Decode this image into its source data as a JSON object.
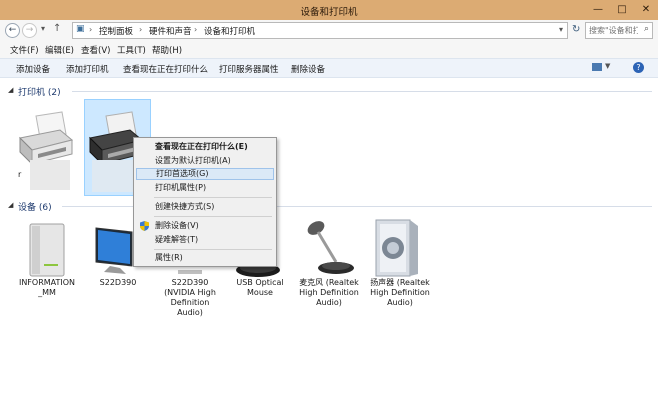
{
  "window": {
    "title": "设备和打印机",
    "min_glyph": "—",
    "max_glyph": "□",
    "close_glyph": "✕"
  },
  "address": {
    "crumbs": [
      "控制面板",
      "硬件和声音",
      "设备和打印机"
    ],
    "search_placeholder": "搜索\"设备和打..."
  },
  "menu": [
    "文件(F)",
    "编辑(E)",
    "查看(V)",
    "工具(T)",
    "帮助(H)"
  ],
  "commands": [
    "添加设备",
    "添加打印机",
    "查看现在正在打印什么",
    "打印服务器属性",
    "删除设备"
  ],
  "printers_section": {
    "title": "打印机 (2)"
  },
  "printers": [
    {
      "label": "r"
    }
  ],
  "devices_section": {
    "title": "设备 (6)"
  },
  "devices": [
    {
      "label_lines": [
        "INFORMATION",
        "_MM"
      ]
    },
    {
      "label_lines": [
        "S22D390"
      ]
    },
    {
      "label_lines": [
        "S22D390",
        "(NVIDIA High",
        "Definition",
        "Audio)"
      ]
    },
    {
      "label_lines": [
        "USB Optical",
        "Mouse"
      ]
    },
    {
      "label_lines": [
        "麦克风 (Realtek",
        "High Definition",
        "Audio)"
      ]
    },
    {
      "label_lines": [
        "扬声器 (Realtek",
        "High Definition",
        "Audio)"
      ]
    }
  ],
  "context_menu": {
    "items": [
      {
        "label": "查看现在正在打印什么(E)"
      },
      {
        "label": "设置为默认打印机(A)"
      },
      {
        "label": "打印首选项(G)"
      },
      {
        "label": "打印机属性(P)"
      },
      {
        "label": "创建快捷方式(S)"
      },
      {
        "label": "删除设备(V)"
      },
      {
        "label": "疑难解答(T)"
      },
      {
        "label": "属性(R)"
      }
    ]
  }
}
